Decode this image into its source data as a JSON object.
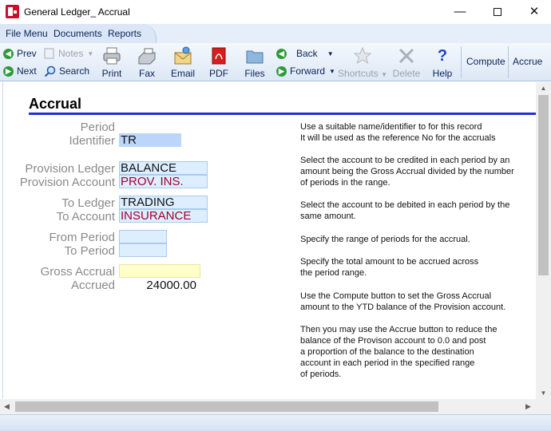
{
  "window": {
    "title": "General Ledger_ Accrual"
  },
  "menu": {
    "items": [
      "File Menu",
      "Documents",
      "Reports"
    ]
  },
  "toolbar": {
    "prev": "Prev",
    "next": "Next",
    "notes": "Notes",
    "search": "Search",
    "print": "Print",
    "fax": "Fax",
    "email": "Email",
    "pdf": "PDF",
    "files": "Files",
    "back": "Back",
    "forward": "Forward",
    "shortcuts": "Shortcuts",
    "delete": "Delete",
    "help": "Help",
    "compute": "Compute",
    "accrue": "Accrue"
  },
  "page": {
    "heading": "Accrual"
  },
  "form": {
    "period_label": "Period",
    "identifier_label": "Identifier",
    "identifier_value": "TR",
    "provision_ledger_label": "Provision Ledger",
    "provision_ledger_value": "BALANCE",
    "provision_account_label": "Provision Account",
    "provision_account_value": "PROV. INS.",
    "to_ledger_label": "To Ledger",
    "to_ledger_value": "TRADING",
    "to_account_label": "To Account",
    "to_account_value": "INSURANCE",
    "from_period_label": "From Period",
    "from_period_value": "",
    "to_period_label": "To Period",
    "to_period_value": "",
    "gross_accrual_label": "Gross Accrual",
    "gross_accrual_value": "",
    "accrued_label": "Accrued",
    "accrued_value": "24000.00"
  },
  "help": {
    "identifier": [
      "Use a suitable name/identifier to for this record",
      "It will be used as the reference No for the accruals"
    ],
    "provision": [
      "Select the account to be credited in each period by an",
      "amount being the Gross Accrual divided by the number",
      "of periods in the range."
    ],
    "to": [
      "Select the account to be debited in each period by the",
      "same amount."
    ],
    "periods": [
      "Specify the range of periods for the accrual."
    ],
    "gross": [
      "Specify the total amount to be accrued across",
      "the period range."
    ],
    "compute": [
      "Use the Compute button to set the Gross Accrual",
      "amount to the YTD balance of the Provision account."
    ],
    "accrue": [
      "Then you may use the Accrue button to reduce the",
      "balance of the Provison account to 0.0 and post",
      "a proportion of the balance to the destination",
      "account in each period in the specified range",
      "of periods."
    ]
  },
  "icons": {
    "app": "general-ledger-app-icon",
    "prev": "prev-arrow-icon",
    "next": "next-arrow-icon",
    "notes": "notes-icon",
    "search": "magnifier-icon",
    "print": "printer-icon",
    "fax": "fax-icon",
    "email": "envelope-icon",
    "pdf": "pdf-icon",
    "files": "folder-icon",
    "back": "back-arrow-icon",
    "forward": "forward-arrow-icon",
    "shortcuts": "star-icon",
    "delete": "x-icon",
    "help": "question-icon"
  }
}
